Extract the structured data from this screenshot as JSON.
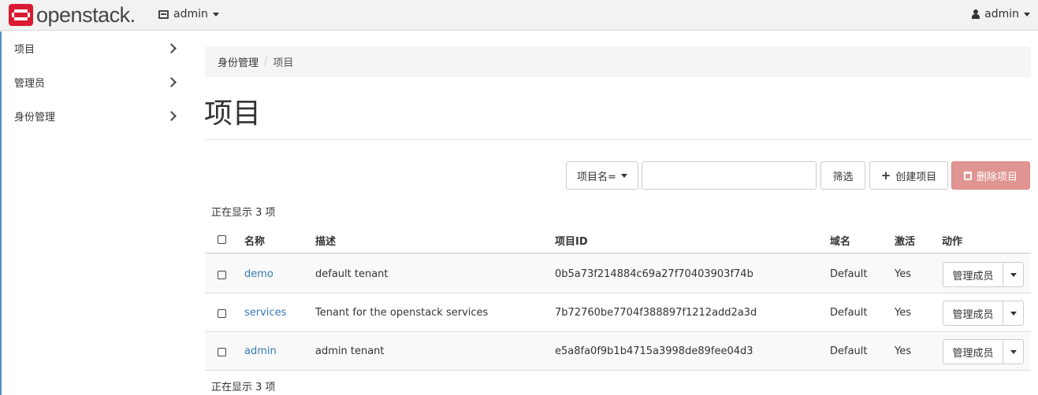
{
  "header": {
    "logo_text": "openstack.",
    "project_label": "admin",
    "user_label": "admin"
  },
  "sidebar": {
    "items": [
      {
        "label": "项目"
      },
      {
        "label": "管理员"
      },
      {
        "label": "身份管理"
      }
    ]
  },
  "breadcrumb": {
    "parent": "身份管理",
    "separator": "/",
    "current": "项目"
  },
  "page": {
    "title": "项目"
  },
  "toolbar": {
    "filter_field": "项目名=",
    "filter_value": "",
    "filter_button": "筛选",
    "create_button": "创建项目",
    "delete_button": "删除项目"
  },
  "table": {
    "count_label_top": "正在显示 3 项",
    "count_label_bottom": "正在显示 3 项",
    "columns": [
      "名称",
      "描述",
      "项目ID",
      "域名",
      "激活",
      "动作"
    ],
    "rows": [
      {
        "name": "demo",
        "description": "default tenant",
        "id": "0b5a73f214884c69a27f70403903f74b",
        "domain": "Default",
        "enabled": "Yes",
        "action": "管理成员"
      },
      {
        "name": "services",
        "description": "Tenant for the openstack services",
        "id": "7b72760be7704f388897f1212add2a3d",
        "domain": "Default",
        "enabled": "Yes",
        "action": "管理成员"
      },
      {
        "name": "admin",
        "description": "admin tenant",
        "id": "e5a8fa0f9b1b4715a3998de89fee04d3",
        "domain": "Default",
        "enabled": "Yes",
        "action": "管理成员"
      }
    ]
  },
  "colors": {
    "brand_red": "#da1a32",
    "link_blue": "#337ab7",
    "danger_disabled": "#e09592",
    "sidebar_accent": "#4a90c2"
  }
}
